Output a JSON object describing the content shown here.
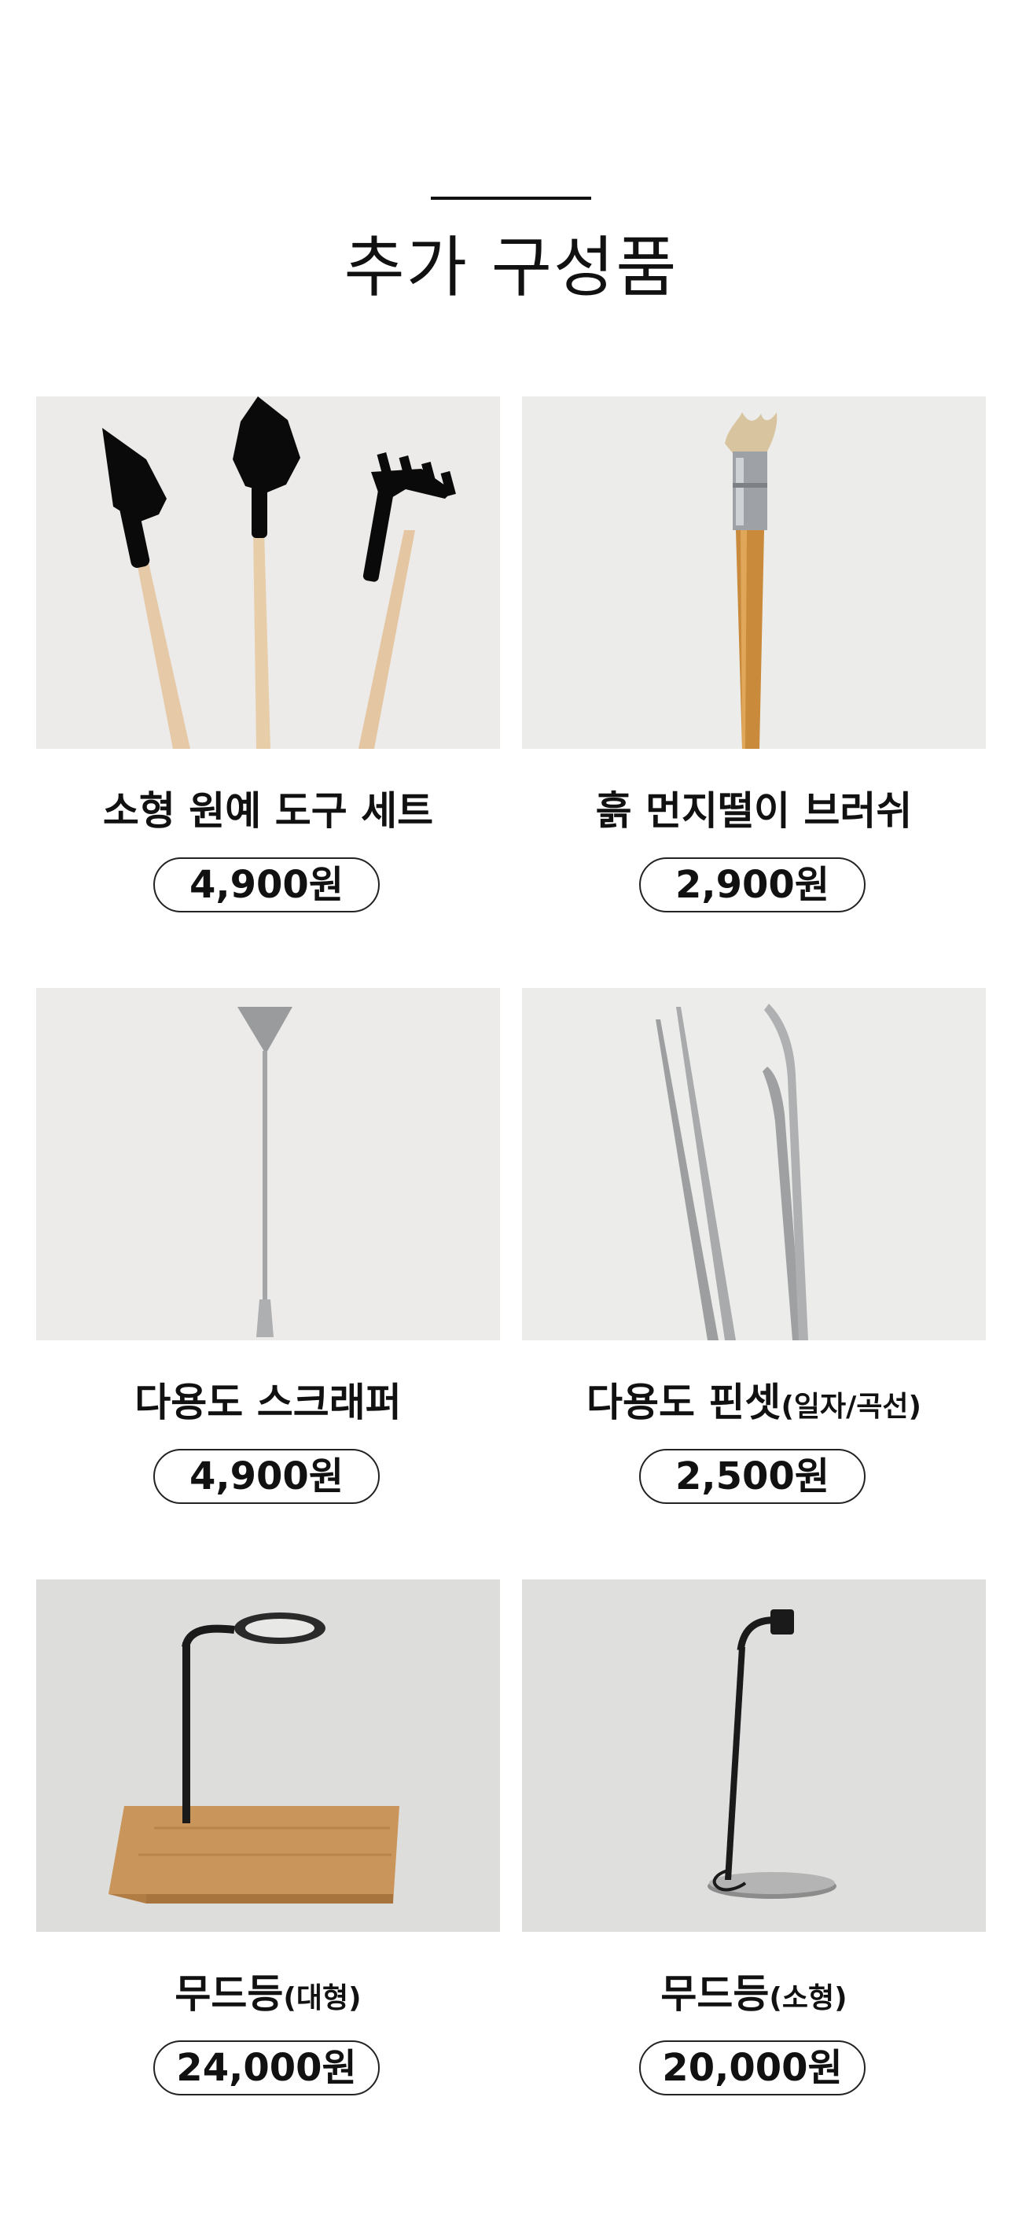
{
  "section": {
    "title": "추가 구성품"
  },
  "products": [
    {
      "name": "소형 원예 도구 세트",
      "name_sub": "",
      "price": "4,900원",
      "image_icon": "garden-tool-set-icon"
    },
    {
      "name": "흙 먼지떨이 브러쉬",
      "name_sub": "",
      "price": "2,900원",
      "image_icon": "dust-brush-icon"
    },
    {
      "name": "다용도 스크래퍼",
      "name_sub": "",
      "price": "4,900원",
      "image_icon": "scraper-icon"
    },
    {
      "name": "다용도 핀셋",
      "name_sub": "(일자/곡선)",
      "price": "2,500원",
      "image_icon": "tweezers-icon"
    },
    {
      "name": "무드등",
      "name_sub": "(대형)",
      "price": "24,000원",
      "image_icon": "mood-lamp-large-icon"
    },
    {
      "name": "무드등",
      "name_sub": "(소형)",
      "price": "20,000원",
      "image_icon": "mood-lamp-small-icon"
    }
  ],
  "colors": {
    "photo_bg_light": "#ececea",
    "photo_bg_grey": "#dddddb",
    "text": "#111111",
    "pill_border": "#222222"
  }
}
